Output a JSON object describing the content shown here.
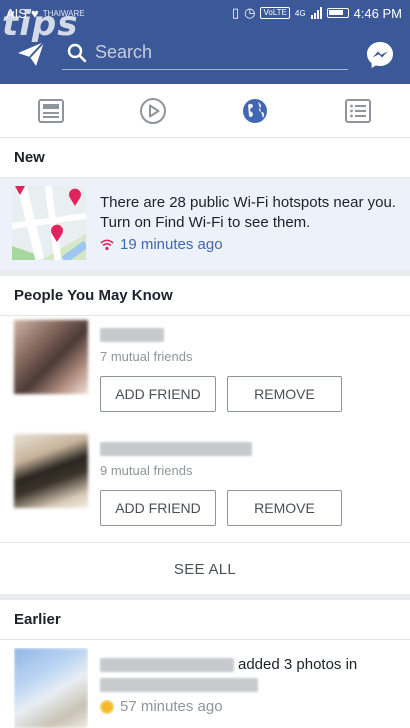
{
  "status_bar": {
    "carrier": "AIS",
    "carrier_sub": "THAIWARE",
    "network": "4G",
    "volte": "VoLTE",
    "time": "4:46 PM"
  },
  "watermark": "tips",
  "search": {
    "placeholder": "Search"
  },
  "tabs": [
    {
      "name": "news-feed",
      "active": false
    },
    {
      "name": "video",
      "active": false
    },
    {
      "name": "notifications",
      "active": true
    },
    {
      "name": "menu",
      "active": false
    }
  ],
  "new_section": {
    "title": "New",
    "notification": {
      "text": "There are 28 public Wi-Fi hotspots near you. Turn on Find Wi-Fi to see them.",
      "time": "19 minutes ago"
    }
  },
  "people_section": {
    "title": "People You May Know",
    "people": [
      {
        "mutual": "7 mutual friends",
        "add_label": "ADD FRIEND",
        "remove_label": "REMOVE"
      },
      {
        "mutual": "9 mutual friends",
        "add_label": "ADD FRIEND",
        "remove_label": "REMOVE"
      }
    ],
    "see_all": "SEE ALL"
  },
  "earlier_section": {
    "title": "Earlier",
    "notification": {
      "action": "added 3 photos in",
      "time": "57 minutes ago"
    }
  },
  "colors": {
    "brand": "#3b5998",
    "active_tab": "#4267b2",
    "unread_bg": "#edf2fa"
  }
}
